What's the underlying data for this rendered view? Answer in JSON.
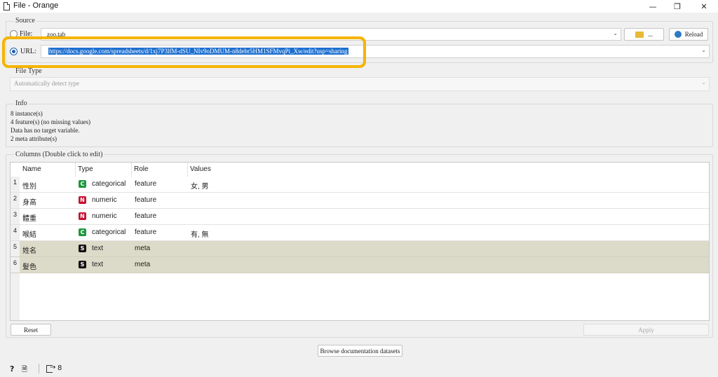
{
  "window": {
    "title": "File - Orange",
    "minimize": "—",
    "restore": "❐",
    "close": "✕"
  },
  "source": {
    "label": "Source",
    "file_label": "File:",
    "file_value": "zoo.tab",
    "browse_label": "...",
    "reload_label": "Reload",
    "url_label": "URL:",
    "url_value": "https://docs.google.com/spreadsheets/d/1xj7P3lfM-dSU_NIv9oDMUM-n8debr5HM1SFMvqPi_Xw/edit?usp=sharing"
  },
  "file_type": {
    "label": "File Type",
    "value": "Automatically detect type"
  },
  "info": {
    "label": "Info",
    "lines": [
      "8 instance(s)",
      "4 feature(s) (no missing values)",
      "Data has no target variable.",
      "2 meta attribute(s)"
    ]
  },
  "columns": {
    "label": "Columns (Double click to edit)",
    "headers": [
      "Name",
      "Type",
      "Role",
      "Values"
    ],
    "rows": [
      {
        "num": "1",
        "name": "性別",
        "type_badge": "C",
        "type": "categorical",
        "role": "feature",
        "values": "女, 男"
      },
      {
        "num": "2",
        "name": "身高",
        "type_badge": "N",
        "type": "numeric",
        "role": "feature",
        "values": ""
      },
      {
        "num": "3",
        "name": "體重",
        "type_badge": "N",
        "type": "numeric",
        "role": "feature",
        "values": ""
      },
      {
        "num": "4",
        "name": "喉結",
        "type_badge": "C",
        "type": "categorical",
        "role": "feature",
        "values": "有, 無"
      },
      {
        "num": "5",
        "name": "姓名",
        "type_badge": "S",
        "type": "text",
        "role": "meta",
        "values": ""
      },
      {
        "num": "6",
        "name": "髮色",
        "type_badge": "S",
        "type": "text",
        "role": "meta",
        "values": ""
      }
    ]
  },
  "buttons": {
    "reset": "Reset",
    "apply": "Apply",
    "browse_docs": "Browse documentation datasets"
  },
  "status": {
    "help": "?",
    "report": "🗎",
    "output_count": "8"
  },
  "colors": {
    "categorical": "#1e9640",
    "numeric": "#c8102e",
    "text": "#111111",
    "highlight": "#f5b400",
    "meta_row": "#dcdac8"
  }
}
